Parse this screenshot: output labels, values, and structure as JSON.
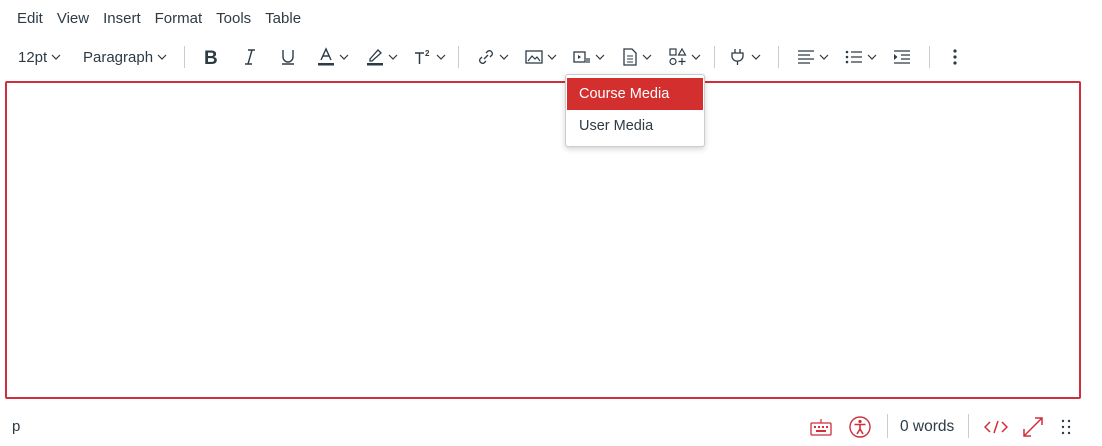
{
  "menubar": {
    "items": [
      "Edit",
      "View",
      "Insert",
      "Format",
      "Tools",
      "Table"
    ]
  },
  "toolbar": {
    "font_size": "12pt",
    "block_format": "Paragraph",
    "icons": [
      "bold-icon",
      "italic-icon",
      "underline-icon",
      "text-color-icon",
      "highlight-color-icon",
      "superscript-icon",
      "link-icon",
      "image-icon",
      "media-icon",
      "document-icon",
      "apps-icon",
      "plugin-icon",
      "align-icon",
      "list-icon",
      "indent-icon",
      "more-vertical-icon"
    ],
    "text_color": "#cf2e3a"
  },
  "media_dropdown": {
    "items": [
      "Course Media",
      "User Media"
    ],
    "active_index": 0,
    "accent": "#d32f2f"
  },
  "editor": {
    "border_color": "#cf2e3a",
    "content": ""
  },
  "statusbar": {
    "path": "p",
    "word_count": "0 words",
    "html_toggle": "</>",
    "accent": "#cf2e3a"
  }
}
